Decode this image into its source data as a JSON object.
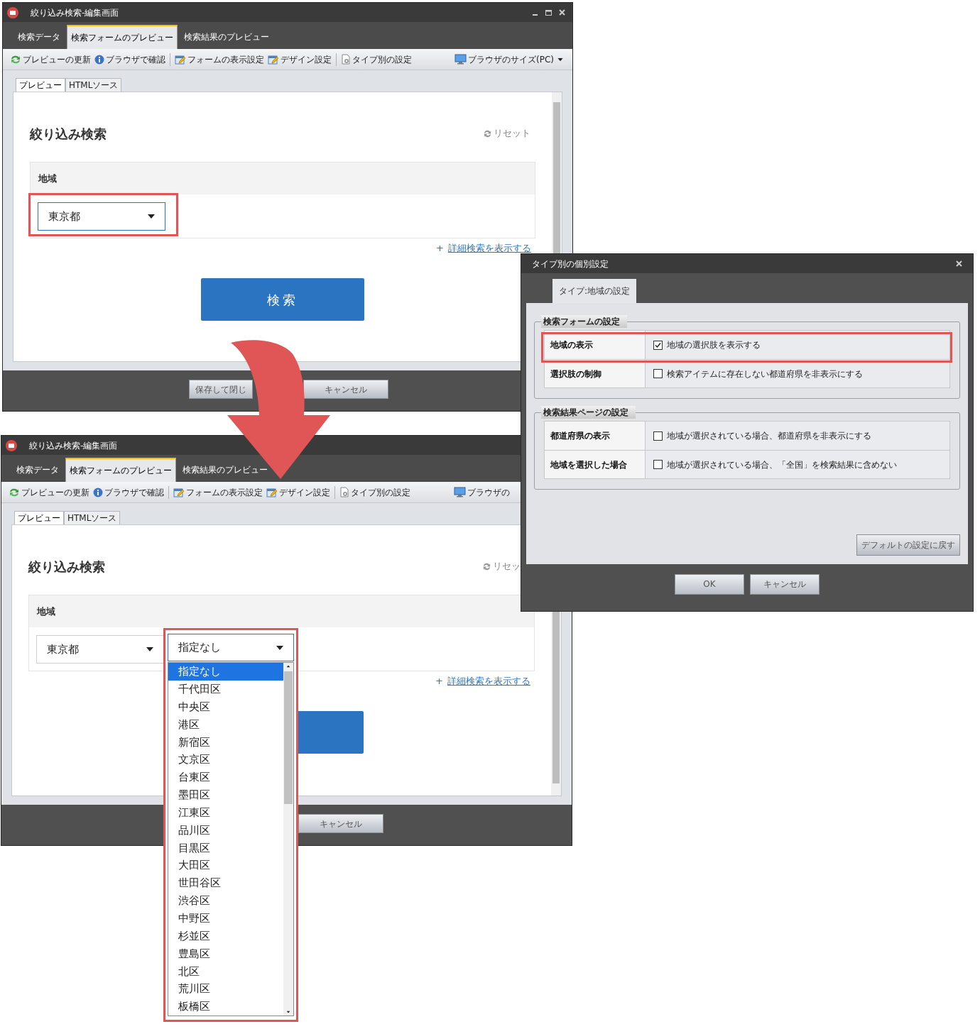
{
  "windows": [
    {
      "title": "絞り込み検索-編集画面",
      "tabs": [
        {
          "label": "検索データ",
          "selected": false
        },
        {
          "label": "検索フォームのプレビュー",
          "selected": true
        },
        {
          "label": "検索結果のプレビュー",
          "selected": false
        }
      ],
      "toolbar": [
        {
          "kind": "refresh",
          "label": "プレビューの更新"
        },
        {
          "kind": "info",
          "label": "ブラウザで確認"
        },
        {
          "kind": "form",
          "label": "フォームの表示設定"
        },
        {
          "kind": "design",
          "label": "デザイン設定"
        },
        {
          "kind": "type",
          "label": "タイプ別の設定"
        },
        {
          "kind": "monitor",
          "label": "ブラウザのサイズ(PC)",
          "caret": true
        }
      ],
      "subtabs": [
        {
          "label": "プレビュー",
          "selected": true
        },
        {
          "label": "HTMLソース",
          "selected": false
        }
      ],
      "form": {
        "heading": "絞り込み検索",
        "reset": "リセット",
        "section_label": "地域",
        "selects": [
          {
            "value": "東京都",
            "expanded": false
          }
        ],
        "detail_link_prefix": "+",
        "detail_link": "詳細検索を表示する",
        "search_button": {
          "kind": "labeled",
          "label": "検索"
        }
      },
      "footer_buttons": [
        "保存して閉じ",
        "キャンセル"
      ]
    },
    {
      "title": "絞り込み検索-編集画面",
      "tabs": [
        {
          "label": "検索データ",
          "selected": false
        },
        {
          "label": "検索フォームのプレビュー",
          "selected": true
        },
        {
          "label": "検索結果のプレビュー",
          "selected": false
        }
      ],
      "toolbar": [
        {
          "kind": "refresh",
          "label": "プレビューの更新"
        },
        {
          "kind": "info",
          "label": "ブラウザで確認"
        },
        {
          "kind": "form",
          "label": "フォームの表示設定"
        },
        {
          "kind": "design",
          "label": "デザイン設定"
        },
        {
          "kind": "type",
          "label": "タイプ別の設定"
        },
        {
          "kind": "monitor",
          "label": "ブラウザの",
          "caret": false
        }
      ],
      "subtabs": [
        {
          "label": "プレビュー",
          "selected": true
        },
        {
          "label": "HTMLソース",
          "selected": false
        }
      ],
      "form": {
        "heading": "絞り込み検索",
        "reset": "リセッ",
        "section_label": "地域",
        "selects": [
          {
            "value": "東京都",
            "expanded": false
          },
          {
            "value": "指定なし",
            "expanded": true,
            "options": [
              {
                "label": "指定なし",
                "selected": true
              },
              {
                "label": "千代田区",
                "selected": false
              },
              {
                "label": "中央区",
                "selected": false
              },
              {
                "label": "港区",
                "selected": false
              },
              {
                "label": "新宿区",
                "selected": false
              },
              {
                "label": "文京区",
                "selected": false
              },
              {
                "label": "台東区",
                "selected": false
              },
              {
                "label": "墨田区",
                "selected": false
              },
              {
                "label": "江東区",
                "selected": false
              },
              {
                "label": "品川区",
                "selected": false
              },
              {
                "label": "目黒区",
                "selected": false
              },
              {
                "label": "大田区",
                "selected": false
              },
              {
                "label": "世田谷区",
                "selected": false
              },
              {
                "label": "渋谷区",
                "selected": false
              },
              {
                "label": "中野区",
                "selected": false
              },
              {
                "label": "杉並区",
                "selected": false
              },
              {
                "label": "豊島区",
                "selected": false
              },
              {
                "label": "北区",
                "selected": false
              },
              {
                "label": "荒川区",
                "selected": false
              },
              {
                "label": "板橋区",
                "selected": false
              }
            ]
          }
        ],
        "detail_link_prefix": "+",
        "detail_link": "詳細検索を表示する",
        "search_button": {
          "kind": "covered"
        }
      },
      "footer_buttons": [
        "キャンセル"
      ]
    }
  ],
  "dialog": {
    "title": "タイプ別の個別設定",
    "tabs": [
      {
        "label": "タイプ:地域の設定",
        "selected": true
      }
    ],
    "groups": [
      {
        "title": "検索フォームの設定",
        "rows": [
          {
            "label": "地域の表示",
            "option": "地域の選択肢を表示する",
            "checked": true
          },
          {
            "label": "選択肢の制御",
            "option": "検索アイテムに存在しない都道府県を非表示にする",
            "checked": false
          }
        ]
      },
      {
        "title": "検索結果ページの設定",
        "rows": [
          {
            "label": "都道府県の表示",
            "option": "地域が選択されている場合、都道府県を非表示にする",
            "checked": false
          },
          {
            "label": "地域を選択した場合",
            "option": "地域が選択されている場合、「全国」を検索結果に含めない",
            "checked": false
          }
        ]
      }
    ],
    "reset_button": "デフォルトの設定に戻す",
    "buttons": [
      "OK",
      "キャンセル"
    ]
  }
}
